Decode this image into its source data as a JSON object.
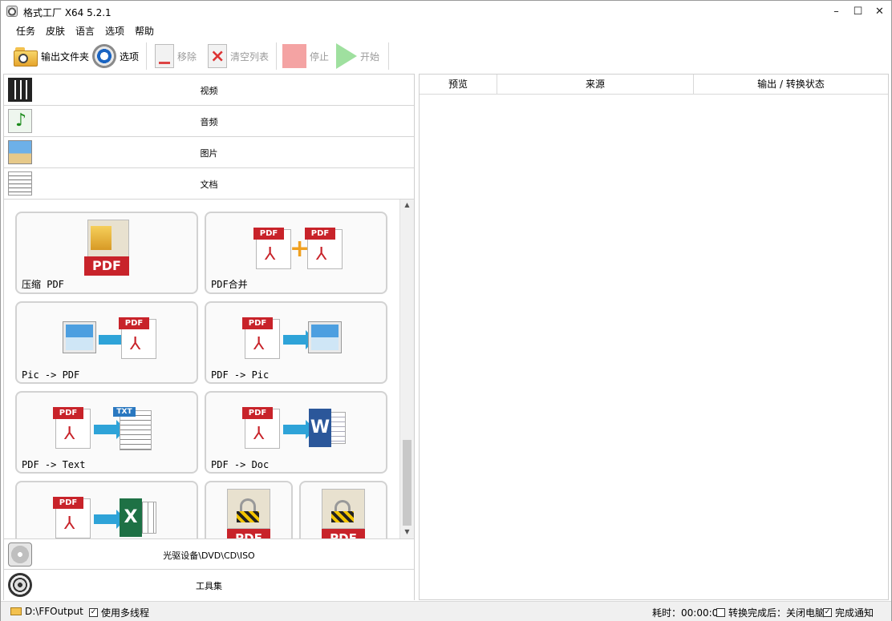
{
  "window": {
    "title": "格式工厂 X64 5.2.1",
    "controls": {
      "minimize": "–",
      "maximize": "☐",
      "close": "✕"
    }
  },
  "menu": [
    "任务",
    "皮肤",
    "语言",
    "选项",
    "帮助"
  ],
  "toolbar": {
    "output_folder": "输出文件夹",
    "options": "选项",
    "remove": "移除",
    "clear_list": "清空列表",
    "stop": "停止",
    "start": "开始"
  },
  "categories": {
    "video": "视频",
    "audio": "音频",
    "image": "图片",
    "document": "文档",
    "disc": "光驱设备\\DVD\\CD\\ISO",
    "tools": "工具集"
  },
  "doc_tools": [
    {
      "label": "压缩 PDF",
      "icon": "compress-pdf-icon"
    },
    {
      "label": "PDF合并",
      "icon": "merge-pdf-icon"
    },
    {
      "label": "Pic -> PDF",
      "icon": "pic-to-pdf-icon"
    },
    {
      "label": "PDF -> Pic",
      "icon": "pdf-to-pic-icon"
    },
    {
      "label": "PDF -> Text",
      "icon": "pdf-to-text-icon"
    },
    {
      "label": "PDF -> Doc",
      "icon": "pdf-to-doc-icon"
    },
    {
      "label": "",
      "icon": "pdf-to-excel-icon"
    },
    {
      "label": "",
      "icon": "unlock-pdf-icon"
    },
    {
      "label": "",
      "icon": "lock-pdf-icon"
    }
  ],
  "task_list": {
    "columns": [
      "预览",
      "来源",
      "输出 / 转换状态"
    ]
  },
  "status": {
    "output_path": "D:\\FFOutput",
    "multithread_label": "使用多线程",
    "multithread_checked": true,
    "elapsed": "耗时：00:00:00",
    "after_done_label": "转换完成后：关闭电脑",
    "after_done_checked": false,
    "notify_label": "完成通知",
    "notify_checked": true
  },
  "colors": {
    "pdf_red": "#c8232a",
    "arrow_blue": "#2ea3d8",
    "start_green": "#9fe09f",
    "stop_red": "#f4a3a3"
  }
}
